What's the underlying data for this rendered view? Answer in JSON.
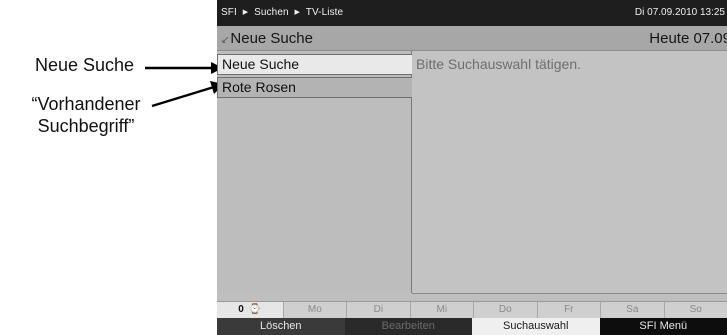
{
  "callouts": {
    "neue_suche": "Neue Suche",
    "vorhandener_line1": "“Vorhandener",
    "vorhandener_line2": "Suchbegriff”"
  },
  "topbar": {
    "crumbs": [
      "SFI",
      "Suchen",
      "TV-Liste"
    ],
    "datetime": "Di 07.09.2010 13:25"
  },
  "titlebar": {
    "title": "Neue Suche",
    "date": "Heute 07.09"
  },
  "list": {
    "items": [
      "Neue Suche",
      "Rote Rosen"
    ],
    "selected_index": 0
  },
  "detail": {
    "hint": "Bitte Suchauswahl tätigen."
  },
  "daybar": {
    "first": "0",
    "first_icon": "clock-icon",
    "days": [
      "Mo",
      "Di",
      "Mi",
      "Do",
      "Fr",
      "Sa",
      "So"
    ]
  },
  "buttons": {
    "red": "Löschen",
    "green": "Bearbeiten",
    "yellow": "Suchauswahl",
    "blue": "SFI Menü"
  },
  "colors": {
    "screen_bg": "#bfbfbf",
    "topbar_bg": "#1e1e1e",
    "selected_row": "#e9e9e9"
  }
}
